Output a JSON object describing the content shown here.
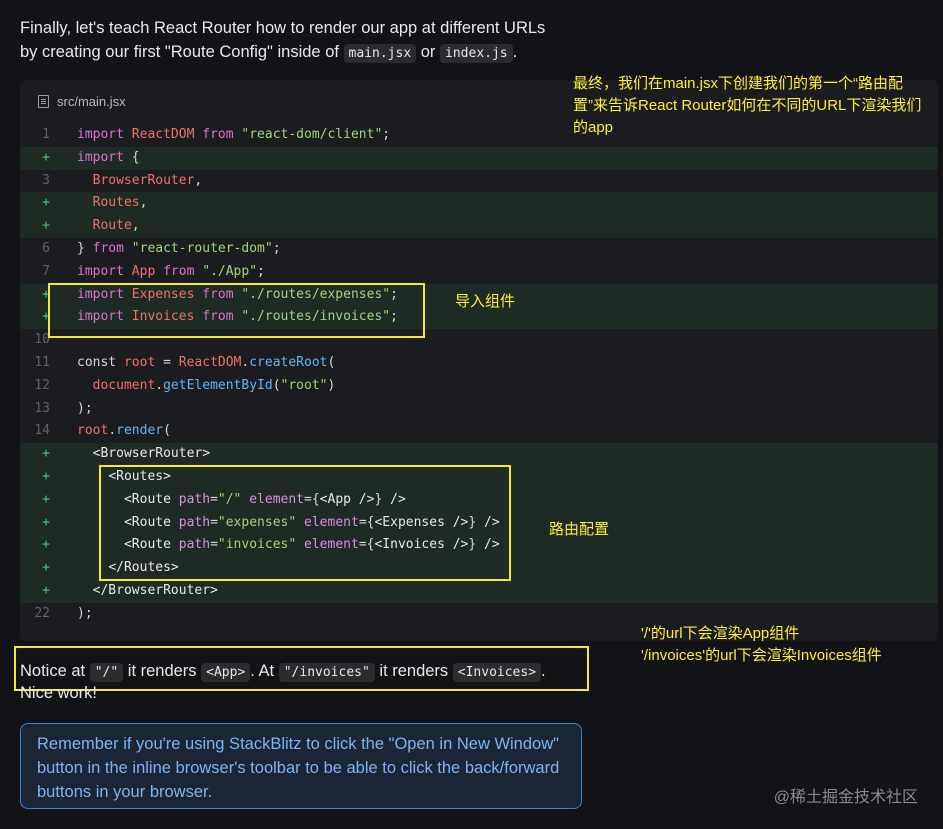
{
  "intro": {
    "line1": "Finally, let's teach React Router how to render our app at different URLs",
    "line2_before": "by creating our first \"Route Config\" inside of ",
    "code_a": "main.jsx",
    "or": " or ",
    "code_b": "index.js",
    "period": "."
  },
  "code_block": {
    "filename": "src/main.jsx",
    "lines": [
      {
        "n": "1",
        "added": false
      },
      {
        "n": "+",
        "added": true
      },
      {
        "n": "3",
        "added": false
      },
      {
        "n": "+",
        "added": true
      },
      {
        "n": "+",
        "added": true
      },
      {
        "n": "6",
        "added": false
      },
      {
        "n": "7",
        "added": false
      },
      {
        "n": "+",
        "added": true
      },
      {
        "n": "+",
        "added": true
      },
      {
        "n": "10",
        "added": false
      },
      {
        "n": "11",
        "added": false
      },
      {
        "n": "12",
        "added": false
      },
      {
        "n": "13",
        "added": false
      },
      {
        "n": "14",
        "added": false
      },
      {
        "n": "+",
        "added": true
      },
      {
        "n": "+",
        "added": true
      },
      {
        "n": "+",
        "added": true
      },
      {
        "n": "+",
        "added": true
      },
      {
        "n": "+",
        "added": true
      },
      {
        "n": "+",
        "added": true
      },
      {
        "n": "+",
        "added": true
      },
      {
        "n": "22",
        "added": false
      }
    ]
  },
  "annotations": {
    "top_right": "最终，我们在main.jsx下创建我们的第一个“路由配置”来告诉React Router如何在不同的URL下渲染我们的app",
    "import_label": "导入组件",
    "route_label": "路由配置",
    "url_line1": "'/'的url下会渲染App组件",
    "url_line2": "'/invoices'的url下会渲染Invoices组件"
  },
  "notice": {
    "p1": "Notice at ",
    "c1": "\"/\"",
    "p2": " it renders ",
    "c2": "<App>",
    "p3": ". At ",
    "c3": "\"/invoices\"",
    "p4": " it renders ",
    "c4": "<Invoices>",
    "p5": ".",
    "nice": "Nice work!"
  },
  "callout": {
    "text": "Remember if you're using StackBlitz to click the \"Open in New Window\" button in the inline browser's toolbar to be able to click the back/forward buttons in your browser."
  },
  "watermark": "@稀土掘金技术社区",
  "colors": {
    "highlight_box": "#f2e93d",
    "annotation_text": "#ffef3a",
    "added_line_bg": "#1e2a24",
    "callout_border": "#3c82d4"
  }
}
